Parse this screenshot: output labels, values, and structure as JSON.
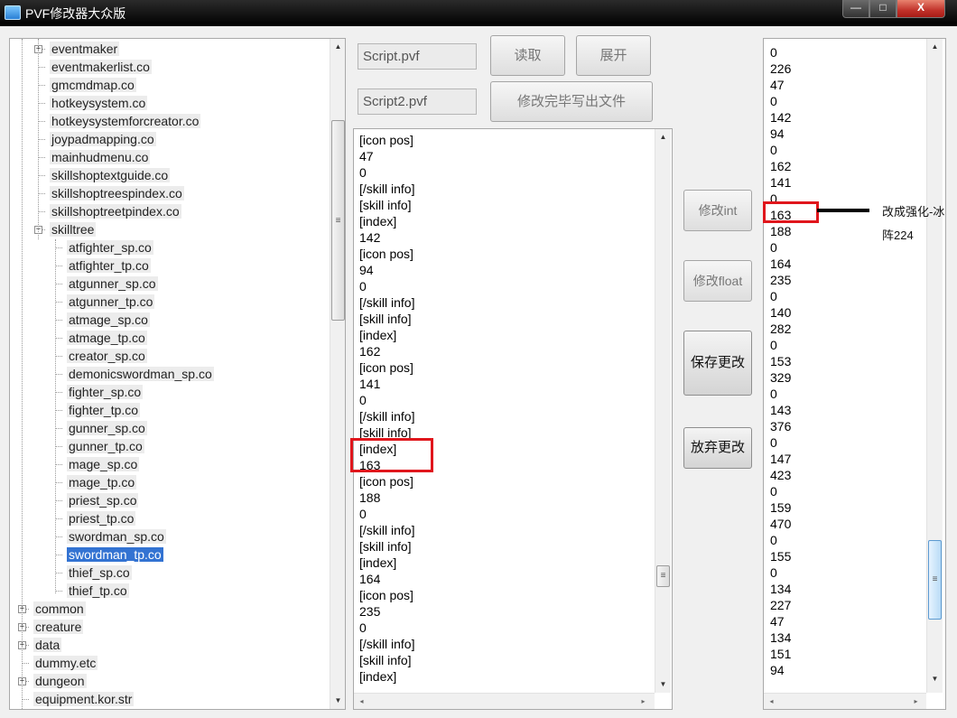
{
  "window": {
    "title": "PVF修改器大众版",
    "minimize": "—",
    "maximize": "□",
    "close": "X"
  },
  "tree": {
    "items": [
      {
        "label": "eventmaker",
        "level": 1,
        "expander": "+"
      },
      {
        "label": "eventmakerlist.co",
        "level": 1
      },
      {
        "label": "gmcmdmap.co",
        "level": 1
      },
      {
        "label": "hotkeysystem.co",
        "level": 1
      },
      {
        "label": "hotkeysystemforcreator.co",
        "level": 1
      },
      {
        "label": "joypadmapping.co",
        "level": 1
      },
      {
        "label": "mainhudmenu.co",
        "level": 1
      },
      {
        "label": "skillshoptextguide.co",
        "level": 1
      },
      {
        "label": "skillshoptreespindex.co",
        "level": 1
      },
      {
        "label": "skillshoptreetpindex.co",
        "level": 1
      },
      {
        "label": "skilltree",
        "level": 1,
        "expander": "−"
      },
      {
        "label": "atfighter_sp.co",
        "level": 2
      },
      {
        "label": "atfighter_tp.co",
        "level": 2
      },
      {
        "label": "atgunner_sp.co",
        "level": 2
      },
      {
        "label": "atgunner_tp.co",
        "level": 2
      },
      {
        "label": "atmage_sp.co",
        "level": 2
      },
      {
        "label": "atmage_tp.co",
        "level": 2
      },
      {
        "label": "creator_sp.co",
        "level": 2
      },
      {
        "label": "demonicswordman_sp.co",
        "level": 2
      },
      {
        "label": "fighter_sp.co",
        "level": 2
      },
      {
        "label": "fighter_tp.co",
        "level": 2
      },
      {
        "label": "gunner_sp.co",
        "level": 2
      },
      {
        "label": "gunner_tp.co",
        "level": 2
      },
      {
        "label": "mage_sp.co",
        "level": 2
      },
      {
        "label": "mage_tp.co",
        "level": 2
      },
      {
        "label": "priest_sp.co",
        "level": 2
      },
      {
        "label": "priest_tp.co",
        "level": 2
      },
      {
        "label": "swordman_sp.co",
        "level": 2
      },
      {
        "label": "swordman_tp.co",
        "level": 2,
        "selected": true
      },
      {
        "label": "thief_sp.co",
        "level": 2
      },
      {
        "label": "thief_tp.co",
        "level": 2
      },
      {
        "label": "common",
        "level": 0,
        "expander": "+"
      },
      {
        "label": "creature",
        "level": 0,
        "expander": "+"
      },
      {
        "label": "data",
        "level": 0,
        "expander": "+"
      },
      {
        "label": "dummy.etc",
        "level": 0
      },
      {
        "label": "dungeon",
        "level": 0,
        "expander": "+"
      },
      {
        "label": "equipment.kor.str",
        "level": 0
      }
    ]
  },
  "files": {
    "script1": "Script.pvf",
    "script2": "Script2.pvf"
  },
  "buttons": {
    "read": "读取",
    "expand": "展开",
    "write_file": "修改完毕写出文件",
    "modify_int": "修改int",
    "modify_float": "修改float",
    "save": "保存更改",
    "discard": "放弃更改"
  },
  "script_lines": [
    "[icon pos]",
    "47",
    "0",
    "[/skill info]",
    "[skill info]",
    "[index]",
    "142",
    "[icon pos]",
    "94",
    "0",
    "[/skill info]",
    "[skill info]",
    "[index]",
    "162",
    "[icon pos]",
    "141",
    "0",
    "[/skill info]",
    "[skill info]",
    "[index]",
    "163",
    "[icon pos]",
    "188",
    "0",
    "[/skill info]",
    "[skill info]",
    "[index]",
    "164",
    "[icon pos]",
    "235",
    "0",
    "[/skill info]",
    "[skill info]",
    "[index]"
  ],
  "numbers": [
    "0",
    "226",
    "47",
    "0",
    "142",
    "94",
    "0",
    "162",
    "141",
    "0",
    "163",
    "188",
    "0",
    "164",
    "235",
    "0",
    "140",
    "282",
    "0",
    "153",
    "329",
    "0",
    "143",
    "376",
    "0",
    "147",
    "423",
    "0",
    "159",
    "470",
    "0",
    "155",
    "0",
    "134",
    "227",
    "47",
    "134",
    "151",
    "94"
  ],
  "annotation": {
    "line1": "改成强化-冰",
    "line2": "阵224"
  },
  "colors": {
    "highlight_red": "#e0161c",
    "selection_blue": "#3373d2"
  },
  "icons": {
    "up": "▲",
    "down": "▼",
    "left": "◂",
    "right": "▸",
    "grip": "≡"
  }
}
